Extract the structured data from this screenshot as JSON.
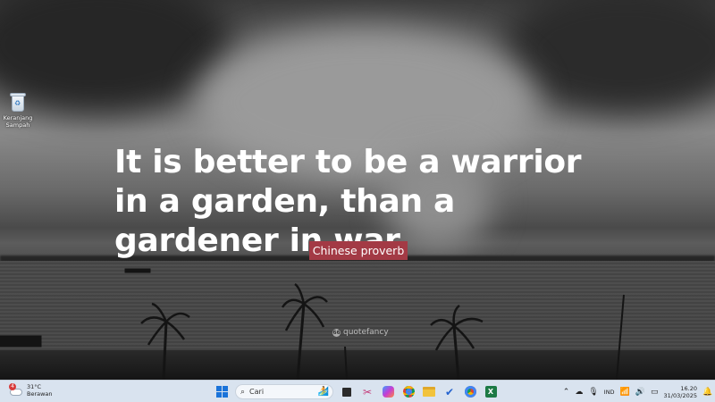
{
  "wallpaper": {
    "quote": "It is better to be a warrior in a garden, than a gardener in war.",
    "author": "Chinese proverb",
    "watermark": "quotefancy"
  },
  "desktop": {
    "icons": [
      {
        "label_line1": "Keranjang",
        "label_line2": "Sampah",
        "icon": "recycle-bin-icon"
      }
    ]
  },
  "taskbar": {
    "weather": {
      "temperature": "31°C",
      "condition": "Berawan",
      "badge": "4"
    },
    "search_placeholder": "Cari",
    "apps": [
      "start-icon",
      "task-view-icon",
      "snipping-tool-icon",
      "copilot-icon",
      "chrome-icon",
      "file-explorer-icon",
      "todo-icon",
      "chrome-profile-icon",
      "excel-icon"
    ],
    "tray": {
      "language": "IND",
      "time": "16.20",
      "date": "31/03/2025"
    }
  },
  "colors": {
    "author_bg": "#a33a45",
    "taskbar_bg": "#d9e3ef"
  }
}
